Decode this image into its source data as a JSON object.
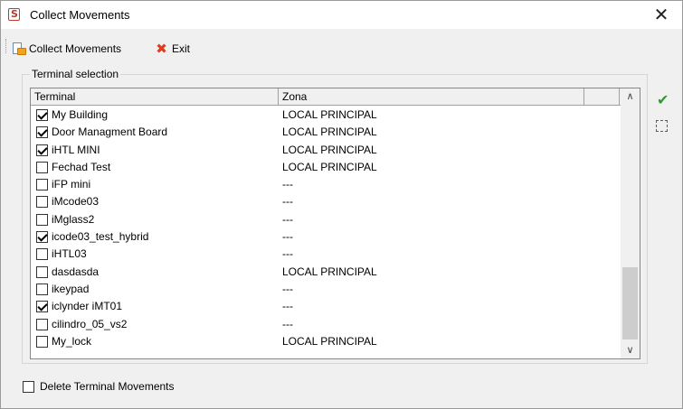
{
  "window": {
    "title": "Collect Movements",
    "close_symbol": "✕"
  },
  "toolbar": {
    "collect_label": "Collect Movements",
    "exit_label": "Exit"
  },
  "terminal_selection": {
    "group_label": "Terminal selection",
    "columns": [
      "Terminal",
      "Zona",
      ""
    ],
    "rows": [
      {
        "name": "My Building",
        "zona": "LOCAL PRINCIPAL",
        "checked": true
      },
      {
        "name": "Door Managment Board",
        "zona": "LOCAL PRINCIPAL",
        "checked": true
      },
      {
        "name": "iHTL MINI",
        "zona": "LOCAL PRINCIPAL",
        "checked": true
      },
      {
        "name": "Fechad Test",
        "zona": "LOCAL PRINCIPAL",
        "checked": false
      },
      {
        "name": "iFP mini",
        "zona": "---",
        "checked": false
      },
      {
        "name": "iMcode03",
        "zona": "---",
        "checked": false
      },
      {
        "name": "iMglass2",
        "zona": "---",
        "checked": false
      },
      {
        "name": "icode03_test_hybrid",
        "zona": "---",
        "checked": true
      },
      {
        "name": "iHTL03",
        "zona": "---",
        "checked": false
      },
      {
        "name": "dasdasda",
        "zona": "LOCAL PRINCIPAL",
        "checked": false
      },
      {
        "name": "ikeypad",
        "zona": "---",
        "checked": false
      },
      {
        "name": "iclynder iMT01",
        "zona": "---",
        "checked": true
      },
      {
        "name": "cilindro_05_vs2",
        "zona": "---",
        "checked": false
      },
      {
        "name": "My_lock",
        "zona": "LOCAL PRINCIPAL",
        "checked": false
      }
    ],
    "scroll_up_symbol": "∧",
    "scroll_down_symbol": "∨"
  },
  "side_actions": {
    "check_all_symbol": "✔"
  },
  "delete_movements": {
    "label": "Delete Terminal Movements",
    "checked": false
  },
  "colors": {
    "check_green": "#2f9b2f",
    "exit_red": "#e23b1d",
    "select_blue": "#2a62c9"
  },
  "icons": [
    "app-logo-icon",
    "collect-movements-icon",
    "exit-icon",
    "check-all-icon",
    "select-all-icon",
    "close-icon"
  ]
}
